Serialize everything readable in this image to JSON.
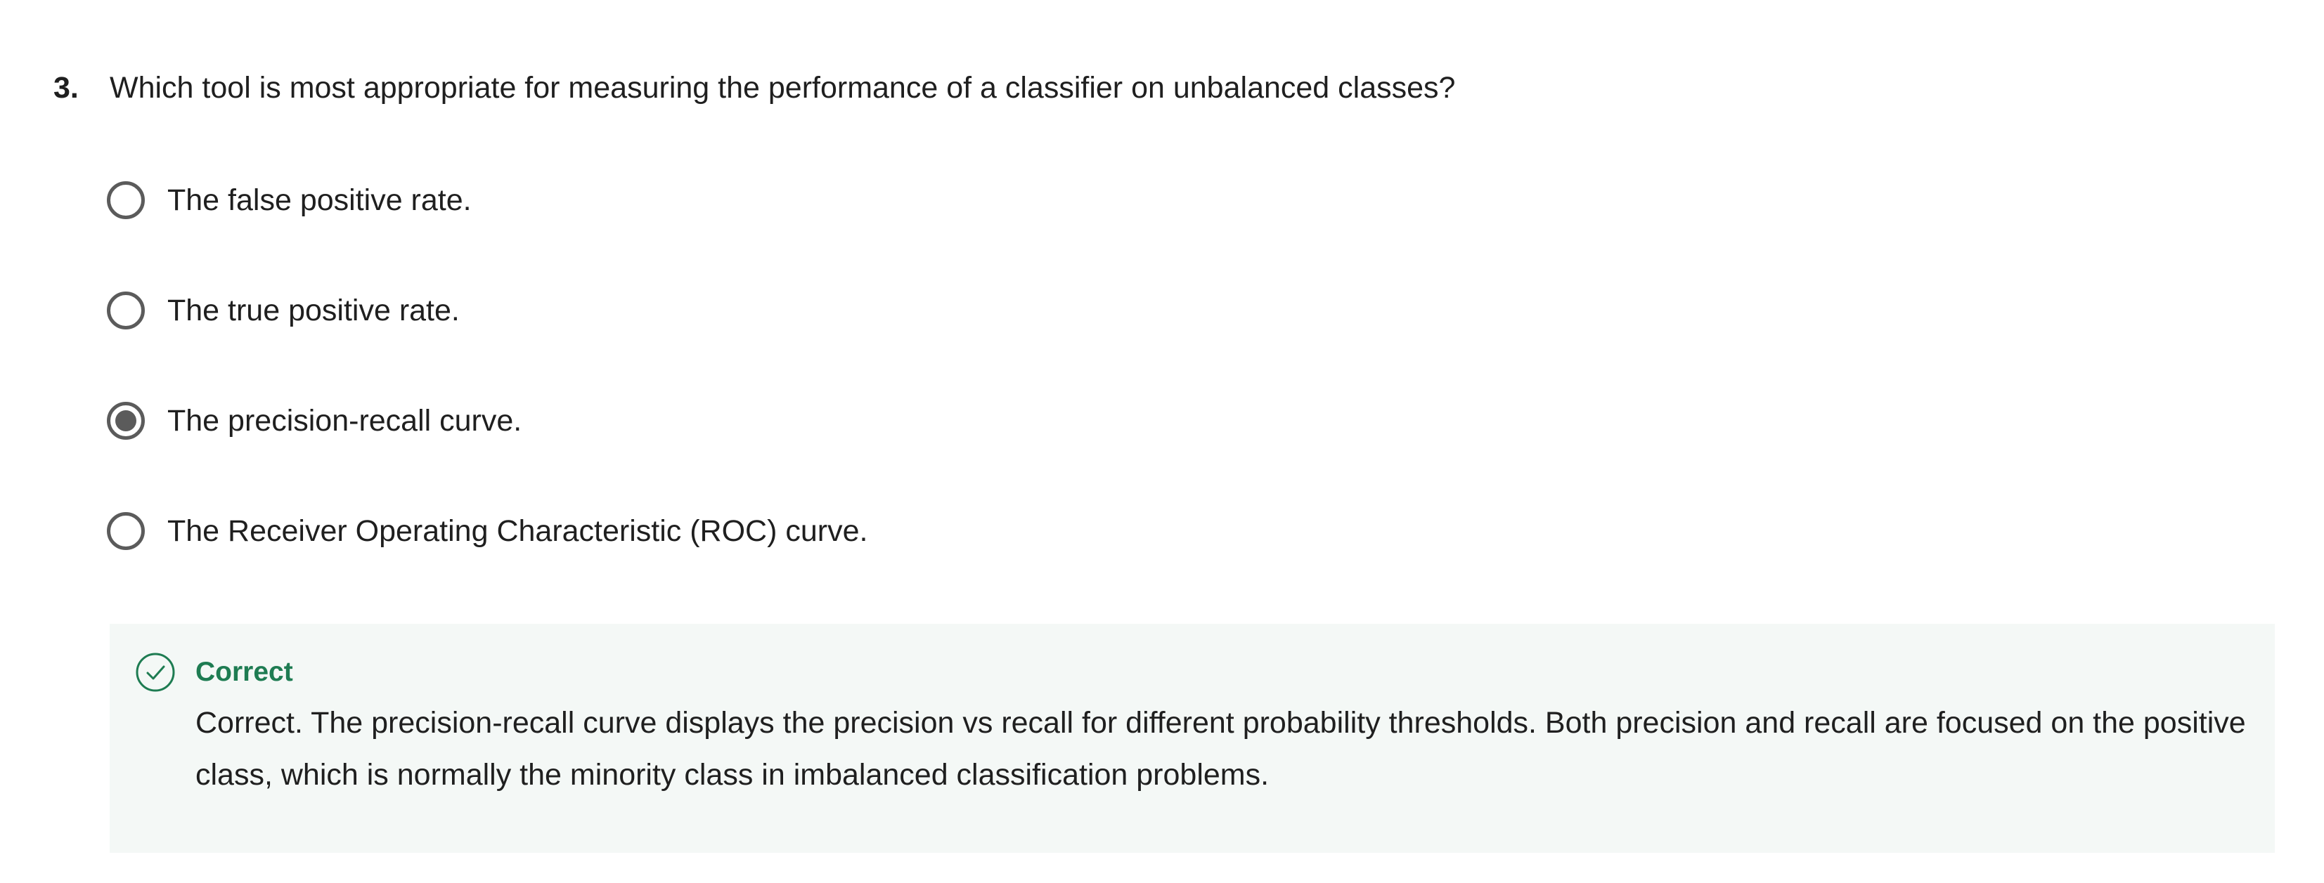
{
  "question": {
    "number": "3.",
    "text": "Which tool is most appropriate for measuring the performance of a classifier on unbalanced classes?"
  },
  "options": [
    {
      "label": "The false positive rate.",
      "selected": false
    },
    {
      "label": "The true positive rate.",
      "selected": false
    },
    {
      "label": "The precision-recall curve.",
      "selected": true
    },
    {
      "label": "The Receiver Operating Characteristic (ROC) curve.",
      "selected": false
    }
  ],
  "feedback": {
    "status": "Correct",
    "text": "Correct. The precision-recall curve displays the precision vs recall for different probability thresholds. Both precision and recall are focused on the positive class, which is normally the minority class in imbalanced classification problems.",
    "icon": "check-circle-icon",
    "accent_color": "#1e7c52",
    "background_color": "#f4f8f6"
  }
}
